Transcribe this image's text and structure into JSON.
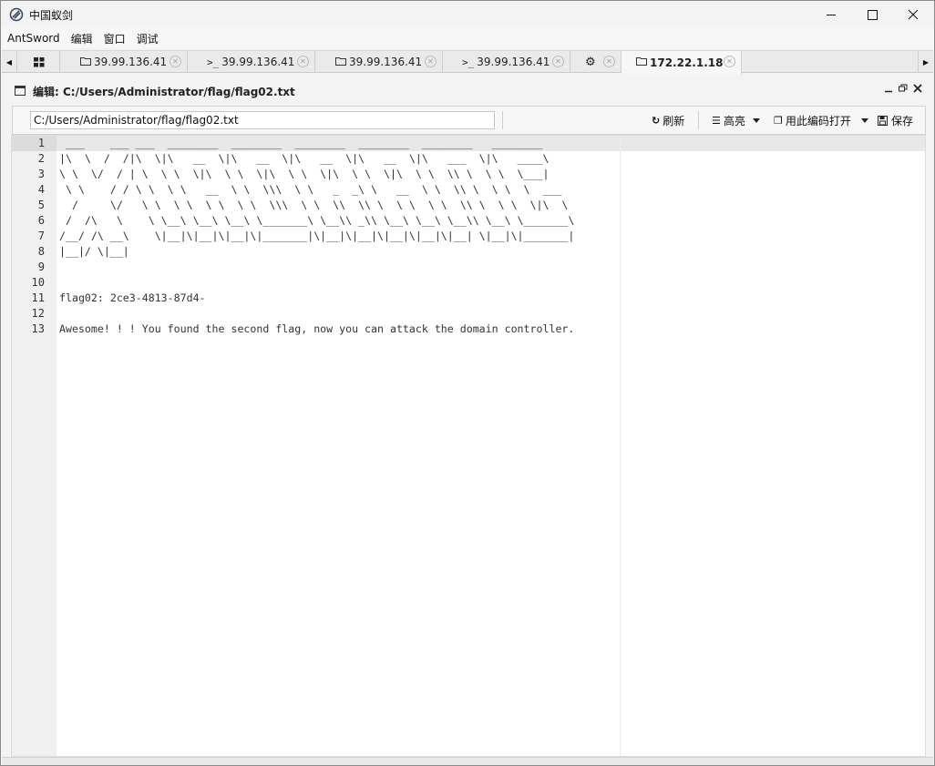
{
  "window": {
    "title": "中国蚁剑"
  },
  "menu": [
    "AntSword",
    "编辑",
    "窗口",
    "调试"
  ],
  "tabs": [
    {
      "icon": "grid-icon",
      "label": "",
      "closable": false
    },
    {
      "icon": "folder-icon",
      "label": "39.99.136.41",
      "closable": true
    },
    {
      "icon": "terminal-icon",
      "label": "39.99.136.41",
      "closable": true
    },
    {
      "icon": "folder-icon",
      "label": "39.99.136.41",
      "closable": true
    },
    {
      "icon": "terminal-icon",
      "label": "39.99.136.41",
      "closable": true
    },
    {
      "icon": "gear-icon",
      "label": "",
      "closable": true
    },
    {
      "icon": "folder-icon",
      "label": "172.22.1.18",
      "closable": true,
      "active": true
    }
  ],
  "panel": {
    "title": "编辑: C:/Users/Administrator/flag/flag02.txt"
  },
  "toolbar": {
    "path_value": "C:/Users/Administrator/flag/flag02.txt",
    "refresh_label": "刷新",
    "highlight_label": "高亮",
    "open_with_encoding_label": "用此编码打开",
    "save_label": "保存"
  },
  "editor": {
    "active_line": 1,
    "lines": [
      " ___    ___ ___  ________  ________  ________  ________  ________   ________",
      "|\\  \\  /  /|\\  \\|\\   __  \\|\\   __  \\|\\   __  \\|\\   __  \\|\\   ___  \\|\\   ____\\",
      "\\ \\  \\/  / | \\  \\ \\  \\|\\  \\ \\  \\|\\  \\ \\  \\|\\  \\ \\  \\|\\  \\ \\  \\\\ \\  \\ \\  \\___|",
      " \\ \\    / / \\ \\  \\ \\   __  \\ \\  \\\\\\  \\ \\   _  _\\ \\   __  \\ \\  \\\\ \\  \\ \\  \\  ___",
      "  /     \\/   \\ \\  \\ \\  \\ \\  \\ \\  \\\\\\  \\ \\  \\\\  \\\\ \\  \\ \\  \\ \\  \\\\ \\  \\ \\  \\|\\  \\",
      " /  /\\   \\    \\ \\__\\ \\__\\ \\__\\ \\_______\\ \\__\\\\ _\\\\ \\__\\ \\__\\ \\__\\\\ \\__\\ \\_______\\",
      "/__/ /\\ __\\    \\|__|\\|__|\\|__|\\|_______|\\|__|\\|__|\\|__|\\|__|\\|__| \\|__|\\|_______|",
      "|__|/ \\|__|",
      "",
      "",
      "flag02: 2ce3-4813-87d4-",
      "",
      "Awesome! ! ! You found the second flag, now you can attack the domain controller."
    ]
  }
}
